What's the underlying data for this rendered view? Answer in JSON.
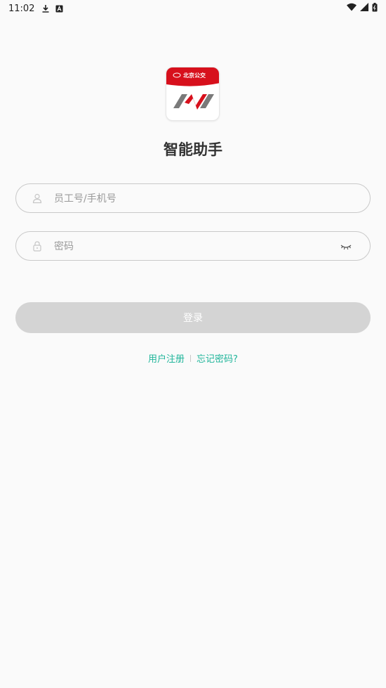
{
  "status_bar": {
    "time": "11:02",
    "left_icons": [
      "download-icon",
      "a-notification-icon"
    ],
    "right_icons": [
      "wifi-icon",
      "signal-icon",
      "battery-icon"
    ]
  },
  "logo": {
    "banner_text": "北京公交",
    "banner_color": "#d7101c",
    "mark_colors": [
      "#d7101c",
      "#7a7a7a"
    ]
  },
  "app": {
    "title": "智能助手"
  },
  "form": {
    "username_placeholder": "员工号/手机号",
    "username_icon": "user-icon",
    "password_placeholder": "密码",
    "password_icon": "lock-icon",
    "password_toggle_icon": "eye-closed-icon",
    "login_label": "登录"
  },
  "links": {
    "register": "用户注册",
    "forgot": "忘记密码?"
  },
  "colors": {
    "accent": "#1fb59a",
    "button_disabled": "#d4d4d4",
    "background": "#fafafa"
  }
}
